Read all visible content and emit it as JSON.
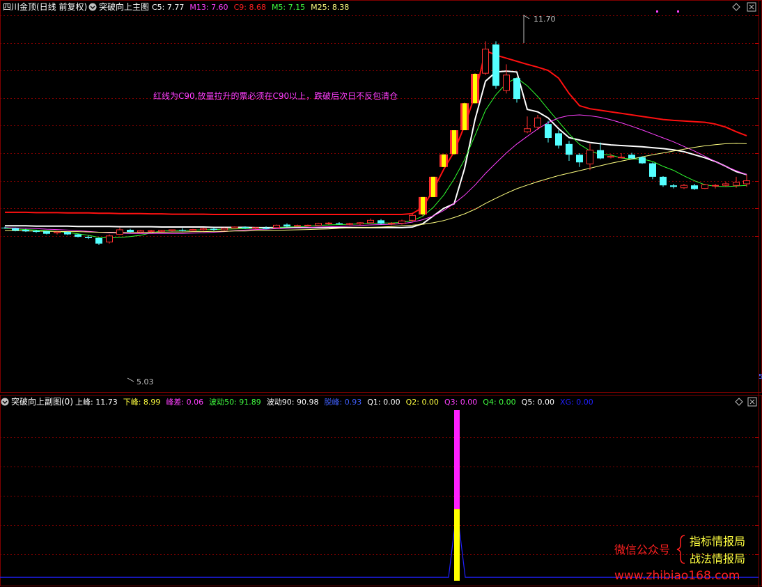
{
  "main_panel": {
    "stock_title": "四川金顶(日线 前复权)",
    "indicator_name": "突破向上主图",
    "legend": [
      {
        "label": "C5: 7.77",
        "color": "#ffffff"
      },
      {
        "label": "M13: 7.60",
        "color": "#ff40ff"
      },
      {
        "label": "C9: 8.68",
        "color": "#ff2020"
      },
      {
        "label": "M5: 7.15",
        "color": "#40ff40"
      },
      {
        "label": "M25: 8.38",
        "color": "#ffff80"
      }
    ],
    "note": "红线为C90,放量拉升的票必须在C90以上，跌破后次日不反包清仓",
    "high_label": "11.70",
    "low_label": "5.03",
    "edge_mark": "5"
  },
  "sub_panel": {
    "indicator_name": "突破向上副图(0)",
    "legend": [
      {
        "label": "上峰: 11.73",
        "color": "#ffffff"
      },
      {
        "label": "下峰: 8.99",
        "color": "#ffff40"
      },
      {
        "label": "峰差: 0.06",
        "color": "#ff40ff"
      },
      {
        "label": "波动50: 91.89",
        "color": "#40ff40"
      },
      {
        "label": "波动90: 90.98",
        "color": "#ffffff"
      },
      {
        "label": "脱峰: 0.93",
        "color": "#4060ff"
      },
      {
        "label": "Q1: 0.00",
        "color": "#ffffff"
      },
      {
        "label": "Q2: 0.00",
        "color": "#ffff40"
      },
      {
        "label": "Q3: 0.00",
        "color": "#ff40ff"
      },
      {
        "label": "Q4: 0.00",
        "color": "#40ff40"
      },
      {
        "label": "Q5: 0.00",
        "color": "#ffffff"
      },
      {
        "label": "XG: 0.00",
        "color": "#2020ff"
      }
    ]
  },
  "watermark": {
    "left": "微信公众号",
    "right_top": "指标情报局",
    "right_bottom": "战法情报局",
    "url": "www.zhibiao168.com"
  },
  "colors": {
    "up_candle": "#ff3030",
    "down_candle": "#54ffff",
    "grid": "#800000",
    "c90": "#ff1010",
    "c5": "#ffffff",
    "m5": "#30ff30",
    "m13": "#ff40ff",
    "m25": "#ffff80",
    "limit_up": "#ffff00"
  },
  "chart_data": [
    {
      "type": "candlestick",
      "price_range": [
        5.03,
        11.7
      ],
      "candles": [
        {
          "o": 5.62,
          "h": 5.65,
          "l": 5.58,
          "c": 5.6
        },
        {
          "o": 5.6,
          "h": 5.62,
          "l": 5.5,
          "c": 5.52
        },
        {
          "o": 5.55,
          "h": 5.58,
          "l": 5.48,
          "c": 5.5
        },
        {
          "o": 5.52,
          "h": 5.55,
          "l": 5.45,
          "c": 5.48
        },
        {
          "o": 5.5,
          "h": 5.52,
          "l": 5.4,
          "c": 5.42
        },
        {
          "o": 5.45,
          "h": 5.5,
          "l": 5.4,
          "c": 5.48
        },
        {
          "o": 5.48,
          "h": 5.5,
          "l": 5.38,
          "c": 5.4
        },
        {
          "o": 5.4,
          "h": 5.42,
          "l": 5.3,
          "c": 5.32
        },
        {
          "o": 5.32,
          "h": 5.36,
          "l": 5.25,
          "c": 5.28
        },
        {
          "o": 5.28,
          "h": 5.3,
          "l": 5.05,
          "c": 5.1
        },
        {
          "o": 5.15,
          "h": 5.4,
          "l": 5.1,
          "c": 5.35
        },
        {
          "o": 5.4,
          "h": 5.62,
          "l": 5.38,
          "c": 5.55
        },
        {
          "o": 5.55,
          "h": 5.58,
          "l": 5.45,
          "c": 5.48
        },
        {
          "o": 5.48,
          "h": 5.55,
          "l": 5.45,
          "c": 5.52
        },
        {
          "o": 5.5,
          "h": 5.55,
          "l": 5.45,
          "c": 5.52
        },
        {
          "o": 5.5,
          "h": 5.55,
          "l": 5.48,
          "c": 5.53
        },
        {
          "o": 5.52,
          "h": 5.56,
          "l": 5.5,
          "c": 5.55
        },
        {
          "o": 5.55,
          "h": 5.6,
          "l": 5.5,
          "c": 5.52
        },
        {
          "o": 5.52,
          "h": 5.58,
          "l": 5.5,
          "c": 5.56
        },
        {
          "o": 5.55,
          "h": 5.62,
          "l": 5.52,
          "c": 5.58
        },
        {
          "o": 5.58,
          "h": 5.62,
          "l": 5.52,
          "c": 5.55
        },
        {
          "o": 5.55,
          "h": 5.62,
          "l": 5.52,
          "c": 5.6
        },
        {
          "o": 5.6,
          "h": 5.66,
          "l": 5.58,
          "c": 5.64
        },
        {
          "o": 5.64,
          "h": 5.66,
          "l": 5.58,
          "c": 5.6
        },
        {
          "o": 5.6,
          "h": 5.64,
          "l": 5.56,
          "c": 5.62
        },
        {
          "o": 5.62,
          "h": 5.66,
          "l": 5.56,
          "c": 5.58
        },
        {
          "o": 5.62,
          "h": 5.72,
          "l": 5.6,
          "c": 5.7
        },
        {
          "o": 5.72,
          "h": 5.76,
          "l": 5.64,
          "c": 5.66
        },
        {
          "o": 5.68,
          "h": 5.72,
          "l": 5.68,
          "c": 5.69
        },
        {
          "o": 5.68,
          "h": 5.72,
          "l": 5.66,
          "c": 5.7
        },
        {
          "o": 5.7,
          "h": 5.78,
          "l": 5.68,
          "c": 5.76
        },
        {
          "o": 5.76,
          "h": 5.8,
          "l": 5.72,
          "c": 5.77
        },
        {
          "o": 5.76,
          "h": 5.8,
          "l": 5.72,
          "c": 5.73
        },
        {
          "o": 5.73,
          "h": 5.78,
          "l": 5.7,
          "c": 5.75
        },
        {
          "o": 5.74,
          "h": 5.8,
          "l": 5.7,
          "c": 5.78
        },
        {
          "o": 5.78,
          "h": 5.92,
          "l": 5.76,
          "c": 5.86
        },
        {
          "o": 5.86,
          "h": 5.9,
          "l": 5.72,
          "c": 5.75
        },
        {
          "o": 5.75,
          "h": 5.8,
          "l": 5.7,
          "c": 5.76
        },
        {
          "o": 5.76,
          "h": 5.88,
          "l": 5.72,
          "c": 5.84
        },
        {
          "o": 5.86,
          "h": 6.1,
          "l": 5.8,
          "c": 6.02
        },
        {
          "o": 6.05,
          "h": 6.62,
          "l": 6.0,
          "c": 6.62
        },
        {
          "o": 6.62,
          "h": 7.28,
          "l": 6.62,
          "c": 7.28
        },
        {
          "o": 7.6,
          "h": 8.02,
          "l": 7.6,
          "c": 8.01
        },
        {
          "o": 8.02,
          "h": 8.8,
          "l": 8.0,
          "c": 8.8
        },
        {
          "o": 8.8,
          "h": 9.7,
          "l": 8.8,
          "c": 9.68
        },
        {
          "o": 9.68,
          "h": 10.66,
          "l": 9.68,
          "c": 10.64
        },
        {
          "o": 10.66,
          "h": 11.7,
          "l": 10.6,
          "c": 11.45
        },
        {
          "o": 11.6,
          "h": 11.7,
          "l": 10.15,
          "c": 10.25
        },
        {
          "o": 10.1,
          "h": 10.95,
          "l": 10.0,
          "c": 10.6
        },
        {
          "o": 10.5,
          "h": 10.52,
          "l": 9.7,
          "c": 9.82
        },
        {
          "o": 8.75,
          "h": 9.25,
          "l": 8.7,
          "c": 8.85
        },
        {
          "o": 8.9,
          "h": 9.3,
          "l": 8.8,
          "c": 9.2
        },
        {
          "o": 9.0,
          "h": 9.1,
          "l": 8.4,
          "c": 8.55
        },
        {
          "o": 8.7,
          "h": 8.8,
          "l": 8.2,
          "c": 8.3
        },
        {
          "o": 8.35,
          "h": 8.45,
          "l": 7.8,
          "c": 8.0
        },
        {
          "o": 8.0,
          "h": 8.05,
          "l": 7.6,
          "c": 7.75
        },
        {
          "o": 7.7,
          "h": 8.35,
          "l": 7.5,
          "c": 8.15
        },
        {
          "o": 8.15,
          "h": 8.4,
          "l": 7.85,
          "c": 7.88
        },
        {
          "o": 7.92,
          "h": 8.02,
          "l": 7.88,
          "c": 7.95
        },
        {
          "o": 7.9,
          "h": 8.05,
          "l": 7.88,
          "c": 7.92
        },
        {
          "o": 8.0,
          "h": 8.06,
          "l": 7.86,
          "c": 7.88
        },
        {
          "o": 7.92,
          "h": 7.95,
          "l": 7.7,
          "c": 7.72
        },
        {
          "o": 7.72,
          "h": 7.75,
          "l": 7.2,
          "c": 7.28
        },
        {
          "o": 7.28,
          "h": 7.3,
          "l": 6.95,
          "c": 7.0
        },
        {
          "o": 7.0,
          "h": 7.05,
          "l": 6.9,
          "c": 6.95
        },
        {
          "o": 6.92,
          "h": 7.05,
          "l": 6.88,
          "c": 7.0
        },
        {
          "o": 7.0,
          "h": 7.05,
          "l": 6.85,
          "c": 6.88
        },
        {
          "o": 6.9,
          "h": 7.05,
          "l": 6.88,
          "c": 7.02
        },
        {
          "o": 6.98,
          "h": 7.05,
          "l": 6.9,
          "c": 7.0
        },
        {
          "o": 7.0,
          "h": 7.12,
          "l": 6.95,
          "c": 7.05
        },
        {
          "o": 7.0,
          "h": 7.28,
          "l": 6.92,
          "c": 7.1
        },
        {
          "o": 7.05,
          "h": 7.35,
          "l": 6.95,
          "c": 7.15
        }
      ],
      "limit_up_days": [
        40,
        41,
        42,
        43,
        44,
        45
      ]
    },
    {
      "type": "line",
      "series": [
        {
          "name": "C9",
          "color": "#ff1010",
          "values": [
            6.12,
            6.12,
            6.12,
            6.11,
            6.11,
            6.11,
            6.1,
            6.1,
            6.1,
            6.09,
            6.09,
            6.08,
            6.08,
            6.08,
            6.07,
            6.07,
            6.06,
            6.06,
            6.06,
            6.06,
            6.05,
            6.05,
            6.05,
            6.05,
            6.05,
            6.05,
            6.05,
            6.05,
            6.05,
            6.05,
            6.05,
            6.05,
            6.05,
            6.05,
            6.05,
            6.05,
            6.05,
            6.05,
            6.05,
            6.08,
            6.28,
            6.85,
            7.52,
            8.1,
            8.95,
            9.95,
            11.4,
            11.25,
            11.15,
            11.05,
            10.95,
            10.86,
            10.75,
            10.5,
            10.0,
            9.6,
            9.5,
            9.45,
            9.4,
            9.35,
            9.3,
            9.25,
            9.2,
            9.15,
            9.12,
            9.1,
            9.08,
            9.06,
            9.0,
            8.9,
            8.75,
            8.62
          ]
        },
        {
          "name": "C5",
          "color": "#ffffff",
          "values": [
            5.68,
            5.68,
            5.68,
            5.67,
            5.67,
            5.67,
            5.67,
            5.66,
            5.66,
            5.66,
            5.66,
            5.65,
            5.65,
            5.65,
            5.65,
            5.64,
            5.64,
            5.64,
            5.64,
            5.64,
            5.63,
            5.63,
            5.63,
            5.63,
            5.62,
            5.62,
            5.62,
            5.62,
            5.62,
            5.62,
            5.62,
            5.62,
            5.62,
            5.62,
            5.62,
            5.62,
            5.62,
            5.62,
            5.62,
            5.64,
            5.75,
            6.0,
            6.25,
            6.4,
            7.55,
            9.15,
            10.4,
            10.7,
            10.73,
            10.7,
            9.48,
            9.4,
            9.2,
            8.85,
            8.56,
            8.48,
            8.4,
            8.36,
            8.32,
            8.3,
            8.28,
            8.26,
            8.23,
            8.2,
            8.16,
            8.1,
            8.0,
            7.9,
            7.78,
            7.62,
            7.45,
            7.35
          ]
        },
        {
          "name": "M5",
          "color": "#30ff30",
          "values": [
            5.6,
            5.58,
            5.56,
            5.54,
            5.52,
            5.5,
            5.46,
            5.42,
            5.37,
            5.3,
            5.28,
            5.3,
            5.33,
            5.37,
            5.45,
            5.51,
            5.52,
            5.53,
            5.54,
            5.55,
            5.56,
            5.57,
            5.58,
            5.59,
            5.6,
            5.6,
            5.62,
            5.64,
            5.65,
            5.67,
            5.69,
            5.71,
            5.72,
            5.73,
            5.74,
            5.76,
            5.77,
            5.77,
            5.79,
            5.85,
            5.99,
            6.28,
            6.68,
            7.21,
            7.84,
            8.63,
            9.45,
            9.96,
            10.33,
            10.51,
            10.25,
            9.9,
            9.48,
            9.08,
            8.68,
            8.34,
            8.13,
            8.01,
            7.99,
            7.89,
            7.86,
            7.86,
            7.78,
            7.62,
            7.49,
            7.31,
            7.15,
            7.02,
            6.97,
            6.96,
            6.98,
            7.0
          ]
        },
        {
          "name": "M13",
          "color": "#ff40ff",
          "values": [
            5.62,
            5.61,
            5.6,
            5.59,
            5.57,
            5.56,
            5.54,
            5.52,
            5.5,
            5.47,
            5.45,
            5.44,
            5.43,
            5.43,
            5.43,
            5.43,
            5.43,
            5.43,
            5.44,
            5.45,
            5.47,
            5.49,
            5.52,
            5.54,
            5.56,
            5.57,
            5.59,
            5.6,
            5.61,
            5.62,
            5.64,
            5.65,
            5.66,
            5.67,
            5.69,
            5.71,
            5.72,
            5.73,
            5.75,
            5.8,
            5.88,
            6.0,
            6.18,
            6.41,
            6.68,
            7.01,
            7.39,
            7.73,
            8.06,
            8.35,
            8.6,
            8.84,
            9.05,
            9.2,
            9.28,
            9.3,
            9.27,
            9.22,
            9.14,
            9.04,
            8.93,
            8.81,
            8.68,
            8.55,
            8.42,
            8.27,
            8.12,
            7.95,
            7.78,
            7.62,
            7.48,
            7.35
          ]
        },
        {
          "name": "M25",
          "color": "#ffff80",
          "values": [
            5.52,
            5.52,
            5.51,
            5.51,
            5.5,
            5.5,
            5.49,
            5.49,
            5.48,
            5.47,
            5.47,
            5.46,
            5.46,
            5.46,
            5.47,
            5.47,
            5.48,
            5.48,
            5.49,
            5.49,
            5.5,
            5.5,
            5.51,
            5.51,
            5.52,
            5.52,
            5.53,
            5.54,
            5.55,
            5.56,
            5.57,
            5.58,
            5.6,
            5.61,
            5.62,
            5.63,
            5.64,
            5.66,
            5.68,
            5.7,
            5.73,
            5.78,
            5.85,
            5.95,
            6.07,
            6.22,
            6.41,
            6.58,
            6.74,
            6.89,
            7.01,
            7.12,
            7.22,
            7.32,
            7.4,
            7.48,
            7.56,
            7.64,
            7.72,
            7.79,
            7.86,
            7.93,
            8.0,
            8.06,
            8.12,
            8.18,
            8.24,
            8.29,
            8.33,
            8.36,
            8.37,
            8.36
          ]
        }
      ]
    },
    {
      "type": "bar",
      "spike_index": 43,
      "magenta_top": 1.0,
      "yellow_top": 0.42,
      "blue_baseline": 0.02
    }
  ]
}
